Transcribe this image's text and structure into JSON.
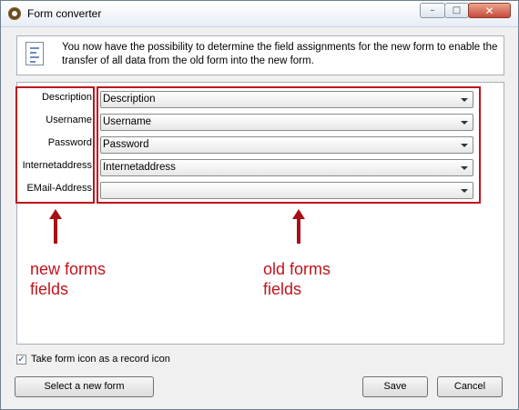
{
  "window": {
    "title": "Form converter",
    "controls": {
      "minimize": "–",
      "maximize": "□",
      "close": "✕"
    }
  },
  "info": {
    "icon": "form-document-icon",
    "text": "You now have the possibility to determine the field assignments for the new form to enable the transfer of all data from the old form into the new form."
  },
  "fields": [
    {
      "label": "Description",
      "value": "Description"
    },
    {
      "label": "Username",
      "value": "Username"
    },
    {
      "label": "Password",
      "value": "Password"
    },
    {
      "label": "Internetaddress",
      "value": "Internetaddress"
    },
    {
      "label": "EMail-Address",
      "value": ""
    }
  ],
  "annotations": {
    "new_label": "new forms fields",
    "old_label": "old forms fields",
    "color": "#c0141c"
  },
  "options": {
    "record_icon_label": "Take form icon as a record icon",
    "record_icon_checked": true
  },
  "buttons": {
    "select_form": "Select a new form",
    "save": "Save",
    "cancel": "Cancel"
  }
}
